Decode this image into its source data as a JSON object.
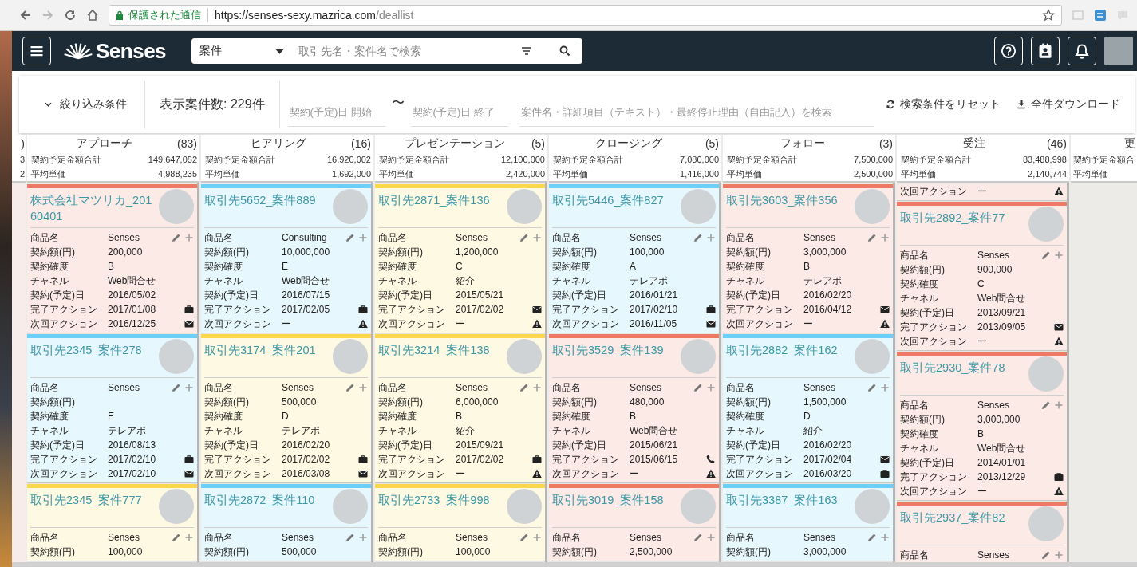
{
  "browser": {
    "security_label": "保護された通信",
    "url_host": "https://senses-sexy.mazrica.com",
    "url_path": "/deallist"
  },
  "header": {
    "logo": "Senses",
    "search": {
      "scope": "案件",
      "placeholder": "取引先名・案件名で検索"
    }
  },
  "filter_bar": {
    "toggle": "絞り込み条件",
    "count": "表示案件数: 229件",
    "date_from_placeholder": "契約(予定)日 開始",
    "range_separator": "〜",
    "date_to_placeholder": "契約(予定)日 終了",
    "text_search_placeholder": "案件名・詳細項目（テキスト）・最終停止理由（自由記入）を検索",
    "reset": "検索条件をリセット",
    "download": "全件ダウンロード"
  },
  "columns": [
    {
      "kind": "stub_left",
      "count": ")",
      "sum_value": "3",
      "avg_value": "2"
    },
    {
      "kind": "full",
      "name": "アプローチ",
      "count": "(83)",
      "sum_label": "契約予定金額合計",
      "sum_value": "149,647,052",
      "avg_label": "平均単価",
      "avg_value": "4,988,235",
      "cards": [
        {
          "kind": "full",
          "title": "株式会社マツリカ_20160401",
          "color": "#ee7a65",
          "rows": [
            {
              "kind": "plain",
              "label": "商品名",
              "value": "Senses"
            },
            {
              "kind": "plain",
              "label": "契約額(円)",
              "value": "200,000"
            },
            {
              "kind": "plain",
              "label": "契約確度",
              "value": "B"
            },
            {
              "kind": "plain",
              "label": "チャネル",
              "value": "Web問合せ"
            },
            {
              "kind": "plain",
              "label": "契約(予定)日",
              "value": "2016/05/02"
            },
            {
              "kind": "task",
              "label": "完了アクション",
              "value": "2017/01/08"
            },
            {
              "kind": "email",
              "label": "次回アクション",
              "value": "2016/12/25"
            }
          ]
        },
        {
          "kind": "full",
          "title": "取引先2345_案件278",
          "color": "#6ccff6",
          "rows": [
            {
              "kind": "plain",
              "label": "商品名",
              "value": "Senses"
            },
            {
              "kind": "plain",
              "label": "契約額(円)"
            },
            {
              "kind": "plain",
              "label": "契約確度",
              "value": "E"
            },
            {
              "kind": "plain",
              "label": "チャネル",
              "value": "テレアポ"
            },
            {
              "kind": "plain",
              "label": "契約(予定)日",
              "value": "2016/08/13"
            },
            {
              "kind": "task",
              "label": "完了アクション",
              "value": "2017/02/10"
            },
            {
              "kind": "email",
              "label": "次回アクション",
              "value": "2017/02/10"
            }
          ]
        },
        {
          "kind": "full",
          "title": "取引先2345_案件777",
          "color": "#fbd84b",
          "rows": [
            {
              "kind": "plain",
              "label": "商品名",
              "value": "Senses"
            },
            {
              "kind": "plain",
              "label": "契約額(円)",
              "value": "100,000"
            }
          ]
        }
      ]
    },
    {
      "kind": "full",
      "name": "ヒアリング",
      "count": "(16)",
      "sum_label": "契約予定金額合計",
      "sum_value": "16,920,002",
      "avg_label": "平均単価",
      "avg_value": "1,692,000",
      "cards": [
        {
          "kind": "full",
          "title": "取引先5652_案件889",
          "color": "#6ccff6",
          "rows": [
            {
              "kind": "plain",
              "label": "商品名",
              "value": "Consulting"
            },
            {
              "kind": "plain",
              "label": "契約額(円)",
              "value": "10,000,000"
            },
            {
              "kind": "plain",
              "label": "契約確度",
              "value": "E"
            },
            {
              "kind": "plain",
              "label": "チャネル",
              "value": "Web問合せ"
            },
            {
              "kind": "plain",
              "label": "契約(予定)日",
              "value": "2016/07/15"
            },
            {
              "kind": "task",
              "label": "完了アクション",
              "value": "2017/02/05"
            },
            {
              "kind": "alert",
              "label": "次回アクション",
              "value": "ー"
            }
          ]
        },
        {
          "kind": "full",
          "title": "取引先3174_案件201",
          "color": "#fbd84b",
          "rows": [
            {
              "kind": "plain",
              "label": "商品名",
              "value": "Senses"
            },
            {
              "kind": "plain",
              "label": "契約額(円)",
              "value": "500,000"
            },
            {
              "kind": "plain",
              "label": "契約確度",
              "value": "D"
            },
            {
              "kind": "plain",
              "label": "チャネル",
              "value": "テレアポ"
            },
            {
              "kind": "plain",
              "label": "契約(予定)日",
              "value": "2016/02/20"
            },
            {
              "kind": "task",
              "label": "完了アクション",
              "value": "2017/02/02"
            },
            {
              "kind": "email",
              "label": "次回アクション",
              "value": "2016/03/08"
            }
          ]
        },
        {
          "kind": "full",
          "title": "取引先2872_案件110",
          "color": "#6ccff6",
          "rows": [
            {
              "kind": "plain",
              "label": "商品名",
              "value": "Senses"
            },
            {
              "kind": "plain",
              "label": "契約額(円)",
              "value": "500,000"
            }
          ]
        }
      ]
    },
    {
      "kind": "full",
      "name": "プレゼンテーション",
      "count": "(5)",
      "sum_label": "契約予定金額合計",
      "sum_value": "12,100,000",
      "avg_label": "平均単価",
      "avg_value": "2,420,000",
      "cards": [
        {
          "kind": "full",
          "title": "取引先2871_案件136",
          "color": "#fbd84b",
          "rows": [
            {
              "kind": "plain",
              "label": "商品名",
              "value": "Senses"
            },
            {
              "kind": "plain",
              "label": "契約額(円)",
              "value": "1,200,000"
            },
            {
              "kind": "plain",
              "label": "契約確度",
              "value": "C"
            },
            {
              "kind": "plain",
              "label": "チャネル",
              "value": "紹介"
            },
            {
              "kind": "plain",
              "label": "契約(予定)日",
              "value": "2015/05/21"
            },
            {
              "kind": "email",
              "label": "完了アクション",
              "value": "2017/02/02"
            },
            {
              "kind": "alert",
              "label": "次回アクション",
              "value": "ー"
            }
          ]
        },
        {
          "kind": "full",
          "title": "取引先3214_案件138",
          "color": "#fbd84b",
          "rows": [
            {
              "kind": "plain",
              "label": "商品名",
              "value": "Senses"
            },
            {
              "kind": "plain",
              "label": "契約額(円)",
              "value": "6,000,000"
            },
            {
              "kind": "plain",
              "label": "契約確度",
              "value": "B"
            },
            {
              "kind": "plain",
              "label": "チャネル",
              "value": "紹介"
            },
            {
              "kind": "plain",
              "label": "契約(予定)日",
              "value": "2015/09/21"
            },
            {
              "kind": "task",
              "label": "完了アクション",
              "value": "2017/02/02"
            },
            {
              "kind": "alert",
              "label": "次回アクション",
              "value": "ー"
            }
          ]
        },
        {
          "kind": "full",
          "title": "取引先2733_案件998",
          "color": "#fbd84b",
          "rows": [
            {
              "kind": "plain",
              "label": "商品名",
              "value": "Senses"
            },
            {
              "kind": "plain",
              "label": "契約額(円)",
              "value": "100,000"
            }
          ]
        }
      ]
    },
    {
      "kind": "full",
      "name": "クロージング",
      "count": "(5)",
      "sum_label": "契約予定金額合計",
      "sum_value": "7,080,000",
      "avg_label": "平均単価",
      "avg_value": "1,416,000",
      "cards": [
        {
          "kind": "full",
          "title": "取引先5446_案件827",
          "color": "#6ccff6",
          "rows": [
            {
              "kind": "plain",
              "label": "商品名",
              "value": "Senses"
            },
            {
              "kind": "plain",
              "label": "契約額(円)",
              "value": "100,000"
            },
            {
              "kind": "plain",
              "label": "契約確度",
              "value": "A"
            },
            {
              "kind": "plain",
              "label": "チャネル",
              "value": "テレアポ"
            },
            {
              "kind": "plain",
              "label": "契約(予定)日",
              "value": "2016/01/21"
            },
            {
              "kind": "task",
              "label": "完了アクション",
              "value": "2017/02/10"
            },
            {
              "kind": "email",
              "label": "次回アクション",
              "value": "2016/11/05"
            }
          ]
        },
        {
          "kind": "full",
          "title": "取引先3529_案件139",
          "color": "#ee7a65",
          "rows": [
            {
              "kind": "plain",
              "label": "商品名",
              "value": "Senses"
            },
            {
              "kind": "plain",
              "label": "契約額(円)",
              "value": "480,000"
            },
            {
              "kind": "plain",
              "label": "契約確度",
              "value": "B"
            },
            {
              "kind": "plain",
              "label": "チャネル",
              "value": "Web問合せ"
            },
            {
              "kind": "plain",
              "label": "契約(予定)日",
              "value": "2015/06/21"
            },
            {
              "kind": "call",
              "label": "完了アクション",
              "value": "2015/06/15"
            },
            {
              "kind": "alert",
              "label": "次回アクション",
              "value": "ー"
            }
          ]
        },
        {
          "kind": "full",
          "title": "取引先3019_案件158",
          "color": "#ee7a65",
          "rows": [
            {
              "kind": "plain",
              "label": "商品名",
              "value": "Senses"
            },
            {
              "kind": "plain",
              "label": "契約額(円)",
              "value": "2,500,000"
            }
          ]
        }
      ]
    },
    {
      "kind": "full",
      "name": "フォロー",
      "count": "(3)",
      "sum_label": "契約予定金額合計",
      "sum_value": "7,500,000",
      "avg_label": "平均単価",
      "avg_value": "2,500,000",
      "cards": [
        {
          "kind": "full",
          "title": "取引先3603_案件356",
          "color": "#ee7a65",
          "rows": [
            {
              "kind": "plain",
              "label": "商品名",
              "value": "Senses"
            },
            {
              "kind": "plain",
              "label": "契約額(円)",
              "value": "3,000,000"
            },
            {
              "kind": "plain",
              "label": "契約確度",
              "value": "B"
            },
            {
              "kind": "plain",
              "label": "チャネル",
              "value": "テレアポ"
            },
            {
              "kind": "plain",
              "label": "契約(予定)日",
              "value": "2016/02/20"
            },
            {
              "kind": "email",
              "label": "完了アクション",
              "value": "2016/04/12"
            },
            {
              "kind": "alert",
              "label": "次回アクション",
              "value": "ー"
            }
          ]
        },
        {
          "kind": "full",
          "title": "取引先2882_案件162",
          "color": "#6ccff6",
          "rows": [
            {
              "kind": "plain",
              "label": "商品名",
              "value": "Senses"
            },
            {
              "kind": "plain",
              "label": "契約額(円)",
              "value": "1,500,000"
            },
            {
              "kind": "plain",
              "label": "契約確度",
              "value": "D"
            },
            {
              "kind": "plain",
              "label": "チャネル",
              "value": "紹介"
            },
            {
              "kind": "plain",
              "label": "契約(予定)日",
              "value": "2016/02/20"
            },
            {
              "kind": "email",
              "label": "完了アクション",
              "value": "2017/02/04"
            },
            {
              "kind": "task",
              "label": "次回アクション",
              "value": "2016/03/20"
            }
          ]
        },
        {
          "kind": "full",
          "title": "取引先3387_案件163",
          "color": "#6ccff6",
          "rows": [
            {
              "kind": "plain",
              "label": "商品名",
              "value": "Senses"
            },
            {
              "kind": "plain",
              "label": "契約額(円)",
              "value": "3,000,000"
            }
          ]
        }
      ]
    },
    {
      "kind": "full",
      "name": "受注",
      "count": "(46)",
      "sum_label": "契約予定金額合計",
      "sum_value": "83,488,998",
      "avg_label": "平均単価",
      "avg_value": "2,140,744",
      "cards": [
        {
          "kind": "tail",
          "rows": [
            {
              "kind": "alert",
              "label": "次回アクション",
              "value": "ー"
            }
          ]
        },
        {
          "kind": "full",
          "title": "取引先2892_案件77",
          "color": "#ee7a65",
          "rows": [
            {
              "kind": "plain",
              "label": "商品名",
              "value": "Senses"
            },
            {
              "kind": "plain",
              "label": "契約額(円)",
              "value": "900,000"
            },
            {
              "kind": "plain",
              "label": "契約確度",
              "value": "C"
            },
            {
              "kind": "plain",
              "label": "チャネル",
              "value": "Web問合せ"
            },
            {
              "kind": "plain",
              "label": "契約(予定)日",
              "value": "2013/09/21"
            },
            {
              "kind": "email",
              "label": "完了アクション",
              "value": "2013/09/05"
            },
            {
              "kind": "alert",
              "label": "次回アクション",
              "value": "ー"
            }
          ]
        },
        {
          "kind": "full",
          "title": "取引先2930_案件78",
          "color": "#ee7a65",
          "rows": [
            {
              "kind": "plain",
              "label": "商品名",
              "value": "Senses"
            },
            {
              "kind": "plain",
              "label": "契約額(円)",
              "value": "3,000,000"
            },
            {
              "kind": "plain",
              "label": "契約確度",
              "value": "B"
            },
            {
              "kind": "plain",
              "label": "チャネル",
              "value": "Web問合せ"
            },
            {
              "kind": "plain",
              "label": "契約(予定)日",
              "value": "2014/01/01"
            },
            {
              "kind": "task",
              "label": "完了アクション",
              "value": "2013/12/29"
            },
            {
              "kind": "alert",
              "label": "次回アクション",
              "value": "ー"
            }
          ]
        },
        {
          "kind": "full",
          "title": "取引先2937_案件82",
          "color": "#ee7a65",
          "rows": [
            {
              "kind": "plain",
              "label": "商品名",
              "value": "Senses"
            }
          ]
        }
      ]
    },
    {
      "kind": "stub_right",
      "name": "更",
      "sum_label": "契約予定金額合",
      "avg_label": "平均単価"
    }
  ]
}
